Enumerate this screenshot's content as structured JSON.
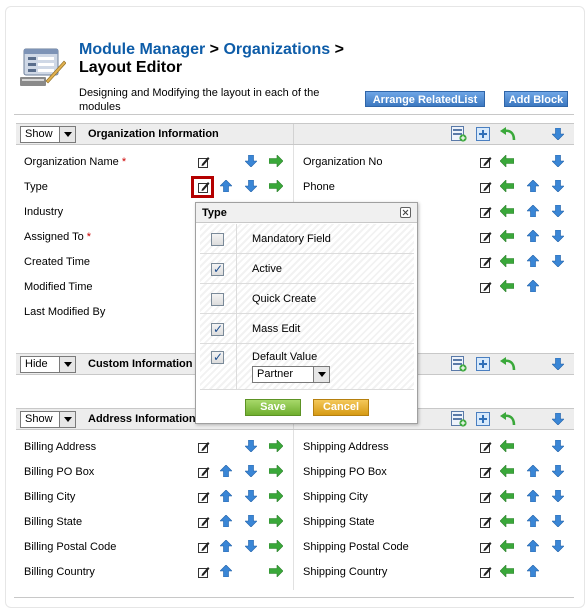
{
  "header": {
    "crumb1": "Module Manager",
    "sep1": " > ",
    "crumb2": "Organizations",
    "sep2": " >",
    "title": "Layout Editor",
    "description": "Designing and Modifying the layout in each of the modules",
    "arrange_button": "Arrange RelatedList",
    "add_block_button": "Add Block"
  },
  "sections": [
    {
      "toggle": "Show",
      "title": "Organization Information",
      "left_fields": [
        {
          "label": "Organization Name",
          "required": true
        },
        {
          "label": "Type",
          "required": false
        },
        {
          "label": "Industry",
          "required": false
        },
        {
          "label": "Assigned To",
          "required": true
        },
        {
          "label": "Created Time",
          "required": false
        },
        {
          "label": "Modified Time",
          "required": false
        },
        {
          "label": "Last Modified By",
          "required": false
        }
      ],
      "right_fields": [
        {
          "label": "Organization No"
        },
        {
          "label": "Phone"
        }
      ]
    },
    {
      "toggle": "Hide",
      "title": "Custom Information"
    },
    {
      "toggle": "Show",
      "title": "Address Information",
      "left_fields": [
        {
          "label": "Billing Address"
        },
        {
          "label": "Billing PO Box"
        },
        {
          "label": "Billing City"
        },
        {
          "label": "Billing State"
        },
        {
          "label": "Billing Postal Code"
        },
        {
          "label": "Billing Country"
        }
      ],
      "right_fields": [
        {
          "label": "Shipping Address"
        },
        {
          "label": "Shipping PO Box"
        },
        {
          "label": "Shipping City"
        },
        {
          "label": "Shipping State"
        },
        {
          "label": "Shipping Postal Code"
        },
        {
          "label": "Shipping Country"
        }
      ]
    }
  ],
  "required_marker": "*",
  "popup": {
    "title": "Type",
    "options": [
      {
        "label": "Mandatory Field",
        "checked": false
      },
      {
        "label": "Active",
        "checked": true
      },
      {
        "label": "Quick Create",
        "checked": false
      },
      {
        "label": "Mass Edit",
        "checked": true
      },
      {
        "label": "Default Value",
        "checked": true
      }
    ],
    "default_value": "Partner",
    "save_label": "Save",
    "cancel_label": "Cancel"
  },
  "colors": {
    "link_blue": "#0d5ca8",
    "button_blue": "#4c8ad1",
    "save_green": "#6fae2e",
    "cancel_orange": "#d69a14",
    "focus_red": "#b40000",
    "arrow_blue": "#3a86d6",
    "arrow_green": "#3aa83a"
  }
}
